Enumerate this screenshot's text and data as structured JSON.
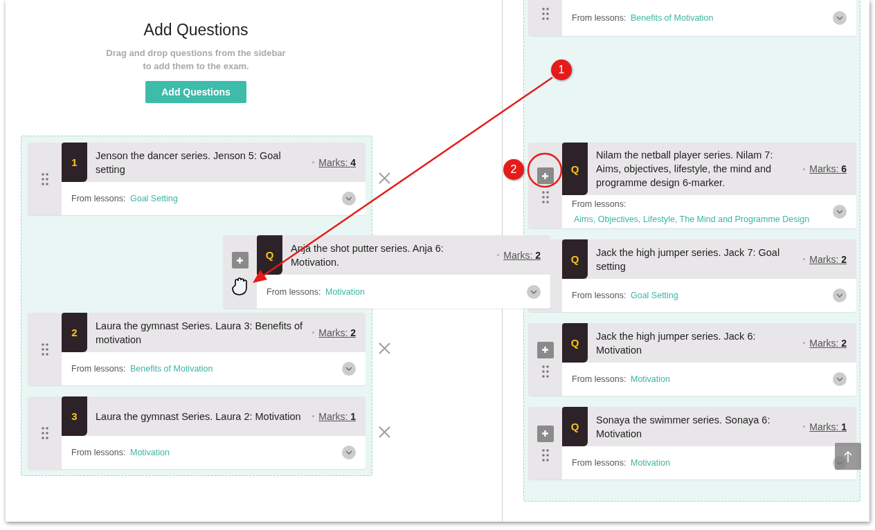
{
  "header": {
    "title": "Add Questions",
    "description": "Drag and drop questions from the sidebar to add them to the exam.",
    "button": "Add Questions"
  },
  "exam_questions": [
    {
      "kind": "question",
      "badge": "1",
      "title": "Jenson the dancer series. Jenson 5: Goal setting",
      "marks_label": "Marks:",
      "marks": "4",
      "lessons_label": "From lessons:",
      "lesson": "Goal Setting"
    },
    {
      "kind": "placeholder"
    },
    {
      "kind": "question",
      "badge": "2",
      "title": "Laura the gymnast Series. Laura 3: Benefits of motivation",
      "marks_label": "Marks:",
      "marks": "2",
      "lessons_label": "From lessons:",
      "lesson": "Benefits of Motivation"
    },
    {
      "kind": "question",
      "badge": "3",
      "title": "Laura the gymnast Series. Laura 2: Motivation",
      "marks_label": "Marks:",
      "marks": "1",
      "lessons_label": "From lessons:",
      "lesson": "Motivation"
    }
  ],
  "dragged_question": {
    "badge": "Q",
    "title": "Anja the shot putter series. Anja 6: Motivation.",
    "marks_label": "Marks:",
    "marks": "2",
    "lessons_label": "From lessons:",
    "lesson": "Motivation"
  },
  "bank_questions": [
    {
      "kind": "partial",
      "lessons_label": "From lessons:",
      "lesson": "Benefits of Motivation"
    },
    {
      "kind": "placeholder"
    },
    {
      "kind": "question",
      "add_button": true,
      "drag_handle": true,
      "badge": "Q",
      "title": "Nilam the netball player series. Nilam 7: Aims, objectives, lifestyle, the mind and programme design 6-marker.",
      "marks_label": "Marks:",
      "marks": "6",
      "lessons_label": "From lessons:",
      "lesson": "Aims, Objectives, Lifestyle, The Mind and Programme Design"
    },
    {
      "kind": "question",
      "add_button": false,
      "drag_handle": false,
      "badge": "Q",
      "title": "Jack the high jumper series. Jack 7: Goal setting",
      "marks_label": "Marks:",
      "marks": "2",
      "lessons_label": "From lessons:",
      "lesson": "Goal Setting"
    },
    {
      "kind": "question",
      "add_button": true,
      "drag_handle": true,
      "badge": "Q",
      "title": "Jack the high jumper series. Jack 6: Motivation",
      "marks_label": "Marks:",
      "marks": "2",
      "lessons_label": "From lessons:",
      "lesson": "Motivation"
    },
    {
      "kind": "question",
      "add_button": true,
      "drag_handle": true,
      "badge": "Q",
      "title": "Sonaya the swimmer series. Sonaya 6: Motivation",
      "marks_label": "Marks:",
      "marks": "1",
      "lessons_label": "From lessons:",
      "lesson": "Motivation"
    }
  ],
  "callouts": [
    "1",
    "2"
  ]
}
